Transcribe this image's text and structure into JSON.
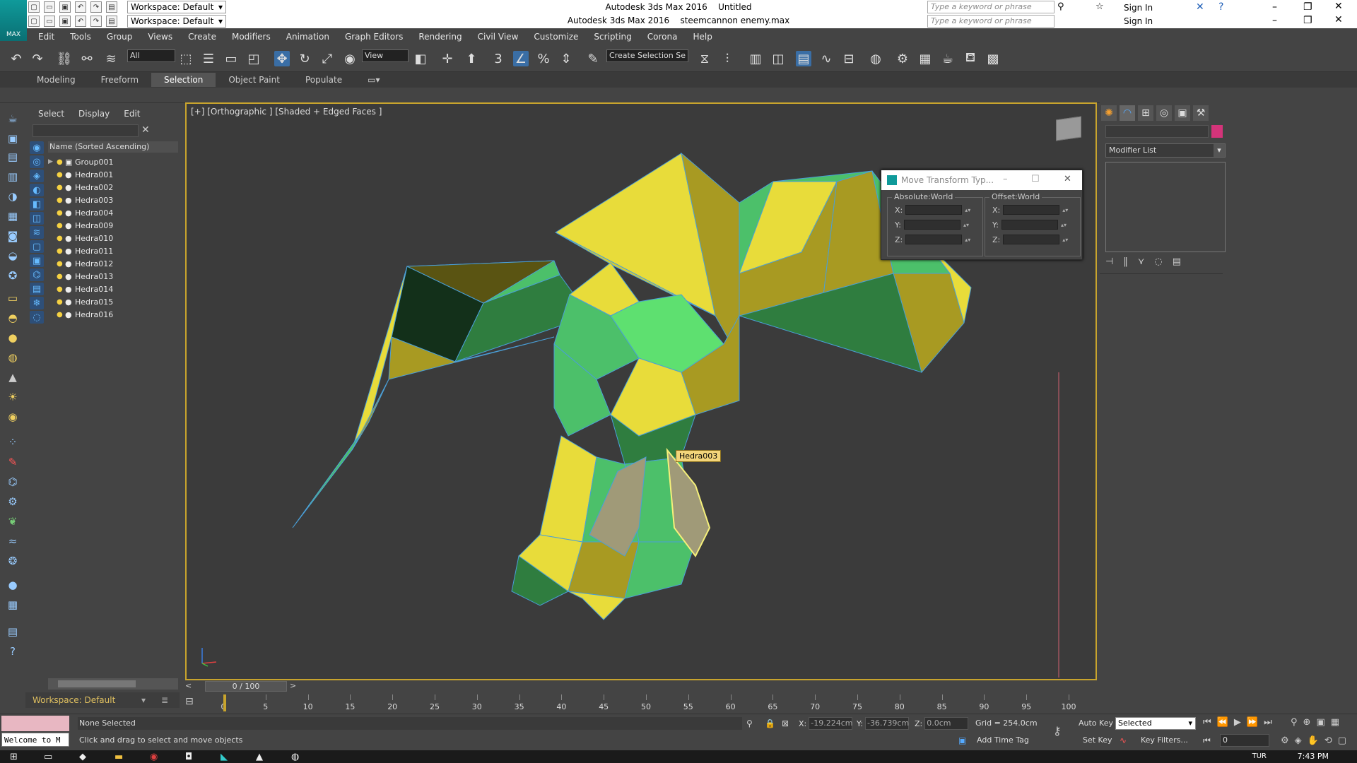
{
  "titlebar": {
    "workspace_label": "Workspace: Default",
    "title_row1_app": "Autodesk 3ds Max 2016",
    "title_row1_file": "Untitled",
    "title_row2_app": "Autodesk 3ds Max 2016",
    "title_row2_file": "steemcannon enemy.max",
    "search_placeholder": "Type a keyword or phrase",
    "sign_in": "Sign In",
    "logo_text": "MAX"
  },
  "menu": [
    "Edit",
    "Tools",
    "Group",
    "Views",
    "Create",
    "Modifiers",
    "Animation",
    "Graph Editors",
    "Rendering",
    "Civil View",
    "Customize",
    "Scripting",
    "Corona",
    "Help"
  ],
  "toolbar": {
    "selection_filter": "All",
    "ref_coord": "View",
    "named_selection_placeholder": "Create Selection Se",
    "snap_label": "3",
    "percent_snap": "%"
  },
  "ribbon": {
    "tabs": [
      "Modeling",
      "Freeform",
      "Selection",
      "Object Paint",
      "Populate"
    ],
    "active": "Selection"
  },
  "explorer": {
    "menu": [
      "Select",
      "Display",
      "Edit"
    ],
    "header": "Name (Sorted Ascending)",
    "items": [
      "Group001",
      "Hedra001",
      "Hedra002",
      "Hedra003",
      "Hedra004",
      "Hedra009",
      "Hedra010",
      "Hedra011",
      "Hedra012",
      "Hedra013",
      "Hedra014",
      "Hedra015",
      "Hedra016"
    ],
    "workspace": "Workspace: Default"
  },
  "viewport": {
    "label": "[+] [Orthographic ] [Shaded + Edged Faces ]",
    "tooltip": "Hedra003",
    "colors": {
      "yellow": "#e8dc3a",
      "olive": "#a89a22",
      "green": "#4cc06a",
      "darkgreen": "#2f7d3f",
      "edge": "#4a9fd8",
      "highlight": "#f5f07a",
      "stone": "#a09a78",
      "border": "#c8a42d"
    }
  },
  "move_transform": {
    "title": "Move Transform Typ...",
    "absolute_label": "Absolute:World",
    "offset_label": "Offset:World",
    "axes": [
      "X:",
      "Y:",
      "Z:"
    ]
  },
  "command_panel": {
    "modifier_list": "Modifier List",
    "color": "#d4347a"
  },
  "timeslider": {
    "position": "0 / 100",
    "ticks": [
      0,
      5,
      10,
      15,
      20,
      25,
      30,
      35,
      40,
      45,
      50,
      55,
      60,
      65,
      70,
      75,
      80,
      85,
      90,
      95,
      100
    ]
  },
  "status": {
    "selection": "None Selected",
    "prompt": "Click and drag to select and move objects",
    "maxscript_text": "Welcome to M",
    "x_label": "X:",
    "x_value": "-19.224cm",
    "y_label": "Y:",
    "y_value": "-36.739cm",
    "z_label": "Z:",
    "z_value": "0.0cm",
    "grid": "Grid = 254.0cm",
    "add_time_tag": "Add Time Tag",
    "auto_key": "Auto Key",
    "set_key": "Set Key",
    "selected_dropdown": "Selected",
    "key_filters": "Key Filters...",
    "current_frame": "0"
  },
  "taskbar": {
    "lang": "TUR",
    "clock": "7:43 PM"
  }
}
